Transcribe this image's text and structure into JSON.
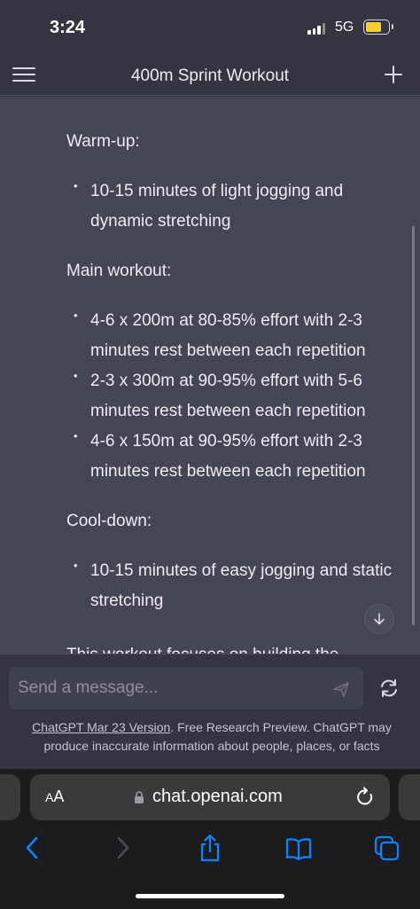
{
  "status_bar": {
    "time": "3:24",
    "network": "5G"
  },
  "header": {
    "title": "400m Sprint Workout",
    "menu_icon": "menu-icon",
    "new_chat_icon": "plus-icon"
  },
  "message": {
    "warmup_heading": "Warm-up:",
    "warmup_items": [
      "10-15 minutes of light jogging and dynamic stretching"
    ],
    "main_heading": "Main workout:",
    "main_items": [
      "4-6 x 200m at 80-85% effort with 2-3 minutes rest between each repetition",
      "2-3 x 300m at 90-95% effort with 5-6 minutes rest between each repetition",
      "4-6 x 150m at 90-95% effort with 2-3 minutes rest between each repetition"
    ],
    "cooldown_heading": "Cool-down:",
    "cooldown_items": [
      "10-15 minutes of easy jogging and static stretching"
    ],
    "truncated_line": "This workout focuses on building the"
  },
  "composer": {
    "placeholder": "Send a message...",
    "send_icon": "send-icon",
    "regenerate_icon": "regenerate-icon"
  },
  "footnote": {
    "link_text": "ChatGPT Mar 23 Version",
    "text": ". Free Research Preview. ChatGPT may produce inaccurate information about people, places, or facts"
  },
  "browser": {
    "text_size_label_big": "A",
    "text_size_label_small": "A",
    "url": "chat.openai.com",
    "icons": [
      "back-icon",
      "forward-icon",
      "share-icon",
      "bookmarks-icon",
      "tabs-icon",
      "reload-icon",
      "lock-icon"
    ]
  },
  "colors": {
    "accent_blue": "#0a84ff",
    "battery_yellow": "#f5d02f",
    "chat_bg": "#444654",
    "page_bg": "#343541"
  }
}
